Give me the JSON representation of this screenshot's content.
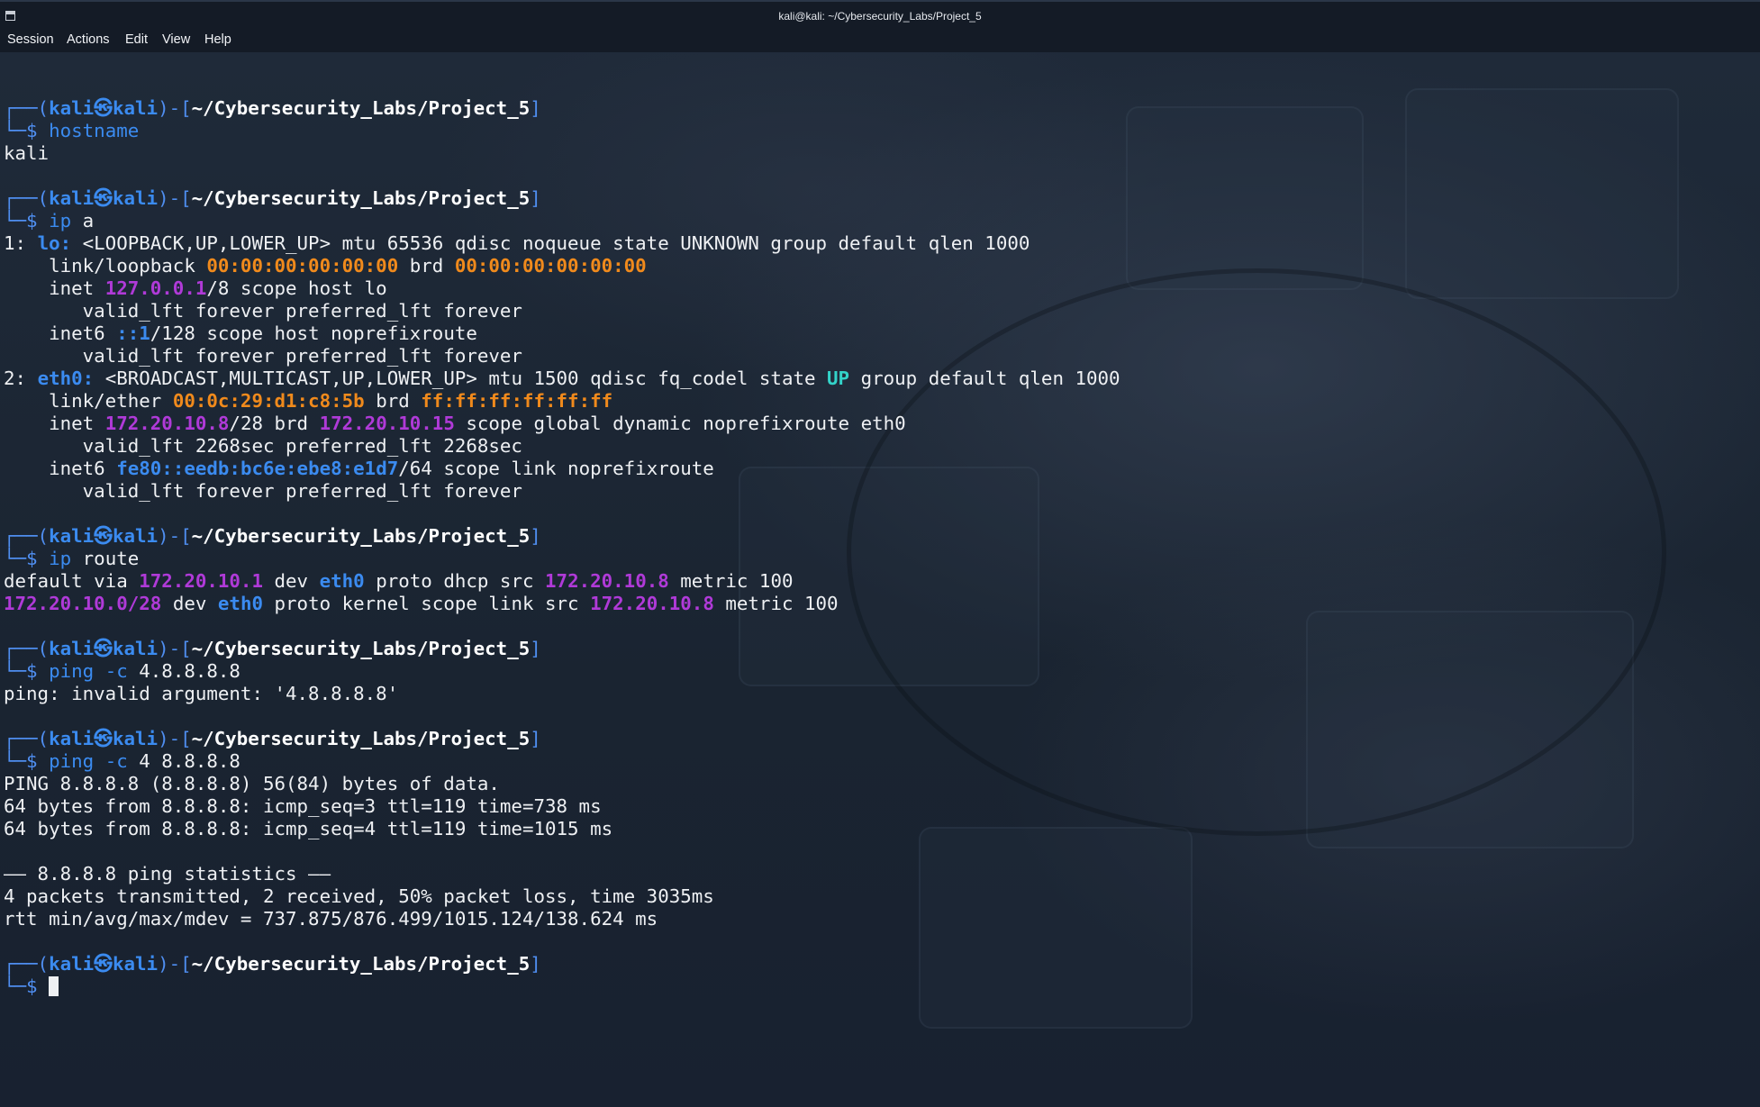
{
  "window": {
    "title": "kali@kali: ~/Cybersecurity_Labs/Project_5"
  },
  "menu": {
    "items": [
      "Session",
      "Actions",
      "Edit",
      "View",
      "Help"
    ]
  },
  "prompt": {
    "frame_top": "┌──(",
    "user": "kali",
    "at": "㉿",
    "host": "kali",
    "frame_mid": ")-[",
    "path": "~/Cybersecurity_Labs/Project_5",
    "frame_end": "]",
    "frame_bottom": "└─",
    "symbol": "$"
  },
  "colors": {
    "background": "#1c2634",
    "text": "#eef0f3",
    "blue": "#3b8bf0",
    "purple": "#b03ad8",
    "orange": "#f08a1c",
    "cyan": "#33d3c9"
  },
  "terminal": {
    "lines": [
      [],
      [
        {
          "t": "┌──(",
          "c": "frame"
        },
        {
          "t": "kali㉿kali",
          "c": "user"
        },
        {
          "t": ")-[",
          "c": "frame"
        },
        {
          "t": "~/Cybersecurity_Labs/Project_5",
          "c": "path"
        },
        {
          "t": "]",
          "c": "frame"
        }
      ],
      [
        {
          "t": "└─",
          "c": "frame"
        },
        {
          "t": "$ ",
          "c": "frame"
        },
        {
          "t": "hostname",
          "c": "cmd"
        }
      ],
      [
        {
          "t": "kali",
          "c": "text"
        }
      ],
      [],
      [
        {
          "t": "┌──(",
          "c": "frame"
        },
        {
          "t": "kali㉿kali",
          "c": "user"
        },
        {
          "t": ")-[",
          "c": "frame"
        },
        {
          "t": "~/Cybersecurity_Labs/Project_5",
          "c": "path"
        },
        {
          "t": "]",
          "c": "frame"
        }
      ],
      [
        {
          "t": "└─",
          "c": "frame"
        },
        {
          "t": "$ ",
          "c": "frame"
        },
        {
          "t": "ip",
          "c": "cmd"
        },
        {
          "t": " a",
          "c": "text"
        }
      ],
      [
        {
          "t": "1: ",
          "c": "text"
        },
        {
          "t": "lo:",
          "c": "iface"
        },
        {
          "t": " <LOOPBACK,UP,LOWER_UP> mtu 65536 qdisc noqueue state UNKNOWN group default qlen 1000",
          "c": "text"
        }
      ],
      [
        {
          "t": "    link/loopback ",
          "c": "text"
        },
        {
          "t": "00:00:00:00:00:00",
          "c": "mac"
        },
        {
          "t": " brd ",
          "c": "text"
        },
        {
          "t": "00:00:00:00:00:00",
          "c": "mac"
        }
      ],
      [
        {
          "t": "    inet ",
          "c": "text"
        },
        {
          "t": "127.0.0.1",
          "c": "ip"
        },
        {
          "t": "/8 scope host lo",
          "c": "text"
        }
      ],
      [
        {
          "t": "       valid_lft forever preferred_lft forever",
          "c": "text"
        }
      ],
      [
        {
          "t": "    inet6 ",
          "c": "text"
        },
        {
          "t": "::1",
          "c": "ip6"
        },
        {
          "t": "/128 scope host noprefixroute",
          "c": "text"
        }
      ],
      [
        {
          "t": "       valid_lft forever preferred_lft forever",
          "c": "text"
        }
      ],
      [
        {
          "t": "2: ",
          "c": "text"
        },
        {
          "t": "eth0:",
          "c": "iface"
        },
        {
          "t": " <BROADCAST,MULTICAST,UP,LOWER_UP> mtu 1500 qdisc fq_codel state ",
          "c": "text"
        },
        {
          "t": "UP",
          "c": "up"
        },
        {
          "t": " group default qlen 1000",
          "c": "text"
        }
      ],
      [
        {
          "t": "    link/ether ",
          "c": "text"
        },
        {
          "t": "00:0c:29:d1:c8:5b",
          "c": "mac"
        },
        {
          "t": " brd ",
          "c": "text"
        },
        {
          "t": "ff:ff:ff:ff:ff:ff",
          "c": "mac"
        }
      ],
      [
        {
          "t": "    inet ",
          "c": "text"
        },
        {
          "t": "172.20.10.8",
          "c": "ip"
        },
        {
          "t": "/28 brd ",
          "c": "text"
        },
        {
          "t": "172.20.10.15",
          "c": "ip"
        },
        {
          "t": " scope global dynamic noprefixroute eth0",
          "c": "text"
        }
      ],
      [
        {
          "t": "       valid_lft 2268sec preferred_lft 2268sec",
          "c": "text"
        }
      ],
      [
        {
          "t": "    inet6 ",
          "c": "text"
        },
        {
          "t": "fe80::eedb:bc6e:ebe8:e1d7",
          "c": "ip6"
        },
        {
          "t": "/64 scope link noprefixroute",
          "c": "text"
        }
      ],
      [
        {
          "t": "       valid_lft forever preferred_lft forever",
          "c": "text"
        }
      ],
      [],
      [
        {
          "t": "┌──(",
          "c": "frame"
        },
        {
          "t": "kali㉿kali",
          "c": "user"
        },
        {
          "t": ")-[",
          "c": "frame"
        },
        {
          "t": "~/Cybersecurity_Labs/Project_5",
          "c": "path"
        },
        {
          "t": "]",
          "c": "frame"
        }
      ],
      [
        {
          "t": "└─",
          "c": "frame"
        },
        {
          "t": "$ ",
          "c": "frame"
        },
        {
          "t": "ip",
          "c": "cmd"
        },
        {
          "t": " route",
          "c": "text"
        }
      ],
      [
        {
          "t": "default via ",
          "c": "text"
        },
        {
          "t": "172.20.10.1",
          "c": "ip"
        },
        {
          "t": " dev ",
          "c": "text"
        },
        {
          "t": "eth0",
          "c": "iface"
        },
        {
          "t": " proto dhcp src ",
          "c": "text"
        },
        {
          "t": "172.20.10.8",
          "c": "ip"
        },
        {
          "t": " metric 100",
          "c": "text"
        }
      ],
      [
        {
          "t": "172.20.10.0/28",
          "c": "ip"
        },
        {
          "t": " dev ",
          "c": "text"
        },
        {
          "t": "eth0",
          "c": "iface"
        },
        {
          "t": " proto kernel scope link src ",
          "c": "text"
        },
        {
          "t": "172.20.10.8",
          "c": "ip"
        },
        {
          "t": " metric 100",
          "c": "text"
        }
      ],
      [],
      [
        {
          "t": "┌──(",
          "c": "frame"
        },
        {
          "t": "kali㉿kali",
          "c": "user"
        },
        {
          "t": ")-[",
          "c": "frame"
        },
        {
          "t": "~/Cybersecurity_Labs/Project_5",
          "c": "path"
        },
        {
          "t": "]",
          "c": "frame"
        }
      ],
      [
        {
          "t": "└─",
          "c": "frame"
        },
        {
          "t": "$ ",
          "c": "frame"
        },
        {
          "t": "ping",
          "c": "cmd"
        },
        {
          "t": " -c",
          "c": "flag"
        },
        {
          "t": " 4.8.8.8.8",
          "c": "text"
        }
      ],
      [
        {
          "t": "ping: invalid argument: '4.8.8.8.8'",
          "c": "text"
        }
      ],
      [],
      [
        {
          "t": "┌──(",
          "c": "frame"
        },
        {
          "t": "kali㉿kali",
          "c": "user"
        },
        {
          "t": ")-[",
          "c": "frame"
        },
        {
          "t": "~/Cybersecurity_Labs/Project_5",
          "c": "path"
        },
        {
          "t": "]",
          "c": "frame"
        }
      ],
      [
        {
          "t": "└─",
          "c": "frame"
        },
        {
          "t": "$ ",
          "c": "frame"
        },
        {
          "t": "ping",
          "c": "cmd"
        },
        {
          "t": " -c",
          "c": "flag"
        },
        {
          "t": " 4 8.8.8.8",
          "c": "text"
        }
      ],
      [
        {
          "t": "PING 8.8.8.8 (8.8.8.8) 56(84) bytes of data.",
          "c": "text"
        }
      ],
      [
        {
          "t": "64 bytes from 8.8.8.8: icmp_seq=3 ttl=119 time=738 ms",
          "c": "text"
        }
      ],
      [
        {
          "t": "64 bytes from 8.8.8.8: icmp_seq=4 ttl=119 time=1015 ms",
          "c": "text"
        }
      ],
      [],
      [
        {
          "t": "—— 8.8.8.8 ping statistics ——",
          "c": "text"
        }
      ],
      [
        {
          "t": "4 packets transmitted, 2 received, 50% packet loss, time 3035ms",
          "c": "text"
        }
      ],
      [
        {
          "t": "rtt min/avg/max/mdev = 737.875/876.499/1015.124/138.624 ms",
          "c": "text"
        }
      ],
      [],
      [
        {
          "t": "┌──(",
          "c": "frame"
        },
        {
          "t": "kali㉿kali",
          "c": "user"
        },
        {
          "t": ")-[",
          "c": "frame"
        },
        {
          "t": "~/Cybersecurity_Labs/Project_5",
          "c": "path"
        },
        {
          "t": "]",
          "c": "frame"
        }
      ],
      [
        {
          "t": "└─",
          "c": "frame"
        },
        {
          "t": "$ ",
          "c": "frame"
        },
        {
          "t": "",
          "c": "cursor"
        }
      ]
    ]
  }
}
